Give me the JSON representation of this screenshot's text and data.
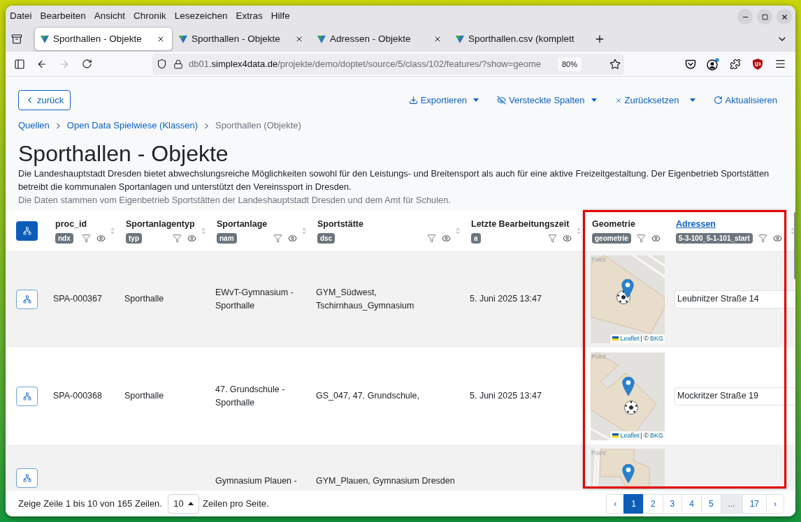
{
  "browser": {
    "menu": [
      "Datei",
      "Bearbeiten",
      "Ansicht",
      "Chronik",
      "Lesezeichen",
      "Extras",
      "Hilfe"
    ],
    "tabs": [
      {
        "title": "Sporthallen - Objekte",
        "selected": true,
        "closable": true
      },
      {
        "title": "Sporthallen - Objekte",
        "selected": false,
        "closable": true
      },
      {
        "title": "Adressen - Objekte",
        "selected": false,
        "closable": true
      },
      {
        "title": "Sporthallen.csv (komplett",
        "selected": false,
        "closable": false
      }
    ],
    "navigation": {
      "back_disabled": false,
      "forward_disabled": true
    },
    "address_bar": {
      "subdomain": "db01.",
      "domain": "simplex4data.de",
      "path": "/projekte/demo/doptet/source/5/class/102/features/?show=geome",
      "zoom": "80%"
    }
  },
  "toolbar": {
    "back_button": "zurück",
    "actions": [
      {
        "label": "Exportieren",
        "kind": "dropdown"
      },
      {
        "label": "Versteckte Spalten",
        "kind": "dropdown"
      },
      {
        "label": "Zurücksetzen",
        "kind": "split"
      },
      {
        "label": "Aktualisieren",
        "kind": "button"
      }
    ]
  },
  "breadcrumbs": [
    {
      "label": "Quellen",
      "kind": "link"
    },
    {
      "label": "Open Data Spielwiese (Klassen)",
      "kind": "link"
    },
    {
      "label": "Sporthallen (Objekte)",
      "kind": "current"
    }
  ],
  "heading": {
    "title": "Sporthallen - Objekte",
    "description": "Die Landeshauptstadt Dresden bietet abwechslungsreiche Möglichkeiten sowohl für den Leistungs- und Breitensport als auch für eine aktive Freizeitgestaltung. Der Eigenbetrieb Sportstätten betreibt die kommunalen Sportanlagen und unterstützt den Vereinssport in Dresden.",
    "source_note": "Die Daten stammen vom Eigenbetrieb Sportstätten der Landeshauptstadt Dresden und dem Amt für Schulen."
  },
  "table": {
    "columns": [
      {
        "title": "proc_id",
        "badge": "ndx",
        "kind": "text"
      },
      {
        "title": "Sportanlagentyp",
        "badge": "typ",
        "kind": "text"
      },
      {
        "title": "Sportanlage",
        "badge": "nam",
        "kind": "text"
      },
      {
        "title": "Sportstätte",
        "badge": "dsc",
        "kind": "text"
      },
      {
        "title": "Letzte Bearbeitungszeit",
        "badge": "a",
        "kind": "text"
      },
      {
        "title": "Geometrie",
        "badge": "geometrie",
        "kind": "map"
      },
      {
        "title": "Adressen",
        "badge": "5-3-100_5-1-101_start",
        "kind": "reference"
      }
    ],
    "rows": [
      {
        "proc_id": "SPA-000367",
        "type": "Sporthalle",
        "facility": "EWvT-Gymnasium - Sporthalle",
        "site": "GYM_Südwest, Tschirnhaus_Gymnasium",
        "modified": "5. Juni 2025 13:47",
        "geometry": {
          "label": "Point",
          "attribution": {
            "link": "Leaflet",
            "text": "| ©",
            "source": "BKG"
          }
        },
        "address": "Leubnitzer Straße 14"
      },
      {
        "proc_id": "SPA-000368",
        "type": "Sporthalle",
        "facility": "47. Grundschule - Sporthalle",
        "site": "GS_047, 47. Grundschule,",
        "modified": "5. Juni 2025 13:47",
        "geometry": {
          "label": "Point",
          "attribution": {
            "link": "Leaflet",
            "text": "| ©",
            "source": "BKG"
          }
        },
        "address": "Mockritzer Straße 19"
      },
      {
        "facility": "Gymnasium Plauen -",
        "site": "GYM_Plauen, Gymnasium Dresden",
        "geometry": {
          "label": "Point"
        }
      }
    ]
  },
  "footer": {
    "summary": "Zeige Zeile 1 bis 10 von 165 Zeilen.",
    "page_size": "10",
    "page_size_label": "Zeilen pro Seite.",
    "previous": "‹",
    "next": "›",
    "pages": [
      {
        "label": "1",
        "selected": true,
        "kind": "page"
      },
      {
        "label": "2",
        "selected": false,
        "kind": "page"
      },
      {
        "label": "3",
        "selected": false,
        "kind": "page"
      },
      {
        "label": "4",
        "selected": false,
        "kind": "page"
      },
      {
        "label": "5",
        "selected": false,
        "kind": "page"
      },
      {
        "label": "...",
        "selected": false,
        "kind": "gap"
      },
      {
        "label": "17",
        "selected": false,
        "kind": "page"
      }
    ]
  }
}
